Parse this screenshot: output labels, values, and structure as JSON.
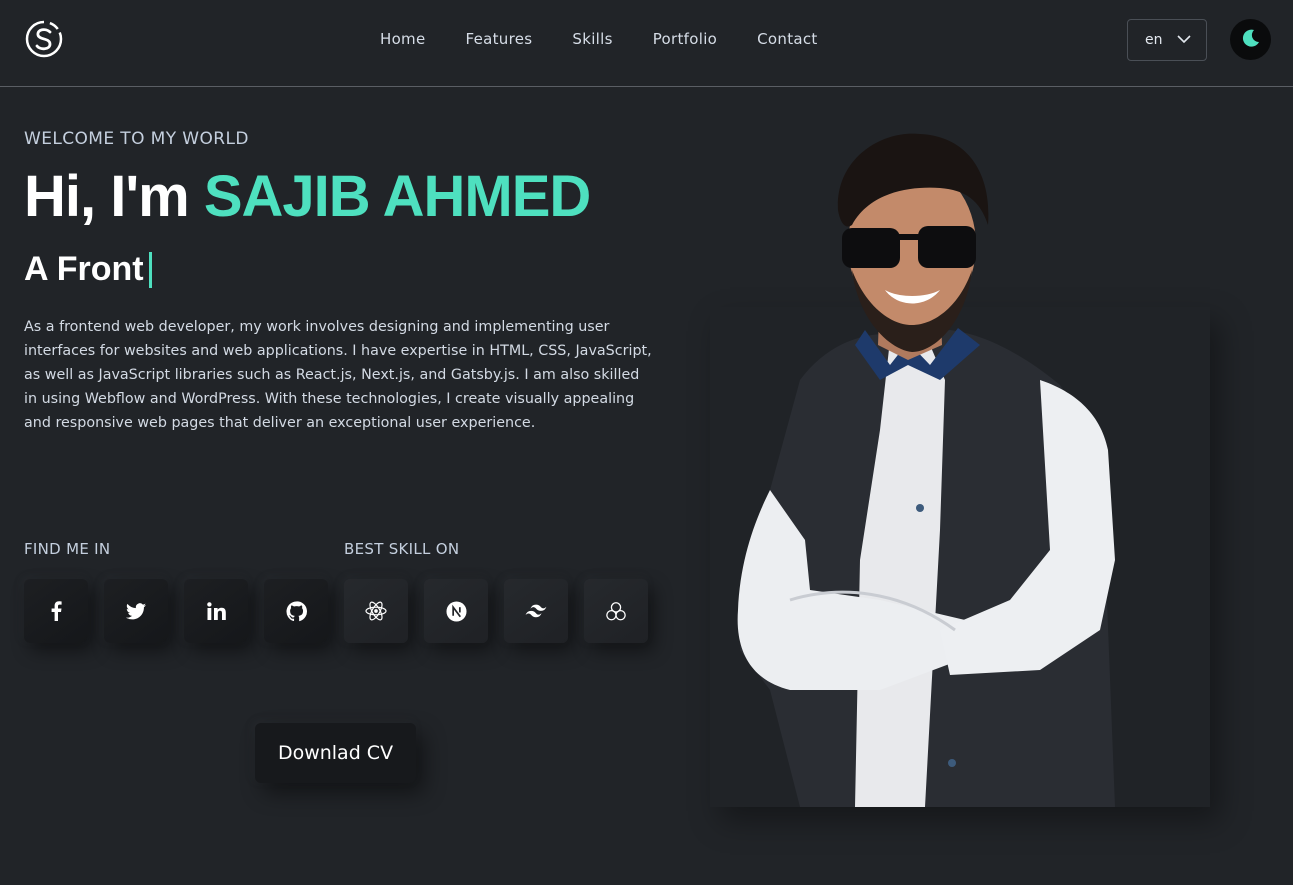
{
  "header": {
    "nav": [
      "Home",
      "Features",
      "Skills",
      "Portfolio",
      "Contact"
    ],
    "language": "en"
  },
  "hero": {
    "eyebrow": "WELCOME TO MY WORLD",
    "greeting": "Hi, I'm",
    "name": "SAJIB AHMED",
    "typed_text": "A Front",
    "bio": "As a frontend web developer, my work involves designing and implementing user interfaces for websites and web applications. I have expertise in HTML, CSS, JavaScript, as well as JavaScript libraries such as React.js, Next.js, and Gatsby.js. I am also skilled in using Webflow and WordPress. With these technologies, I create visually appealing and responsive web pages that deliver an exceptional user experience.",
    "find_me_label": "FIND ME IN",
    "best_skill_label": "BEST SKILL ON",
    "social_icons": [
      "facebook-icon",
      "twitter-icon",
      "linkedin-icon",
      "github-icon"
    ],
    "skill_icons": [
      "react-icon",
      "nextjs-icon",
      "tailwind-icon",
      "gatsby-icon"
    ],
    "cv_button": "Downlad CV"
  },
  "colors": {
    "background": "#212428",
    "accent": "#4ee0bf",
    "text": "#c4cfde"
  }
}
